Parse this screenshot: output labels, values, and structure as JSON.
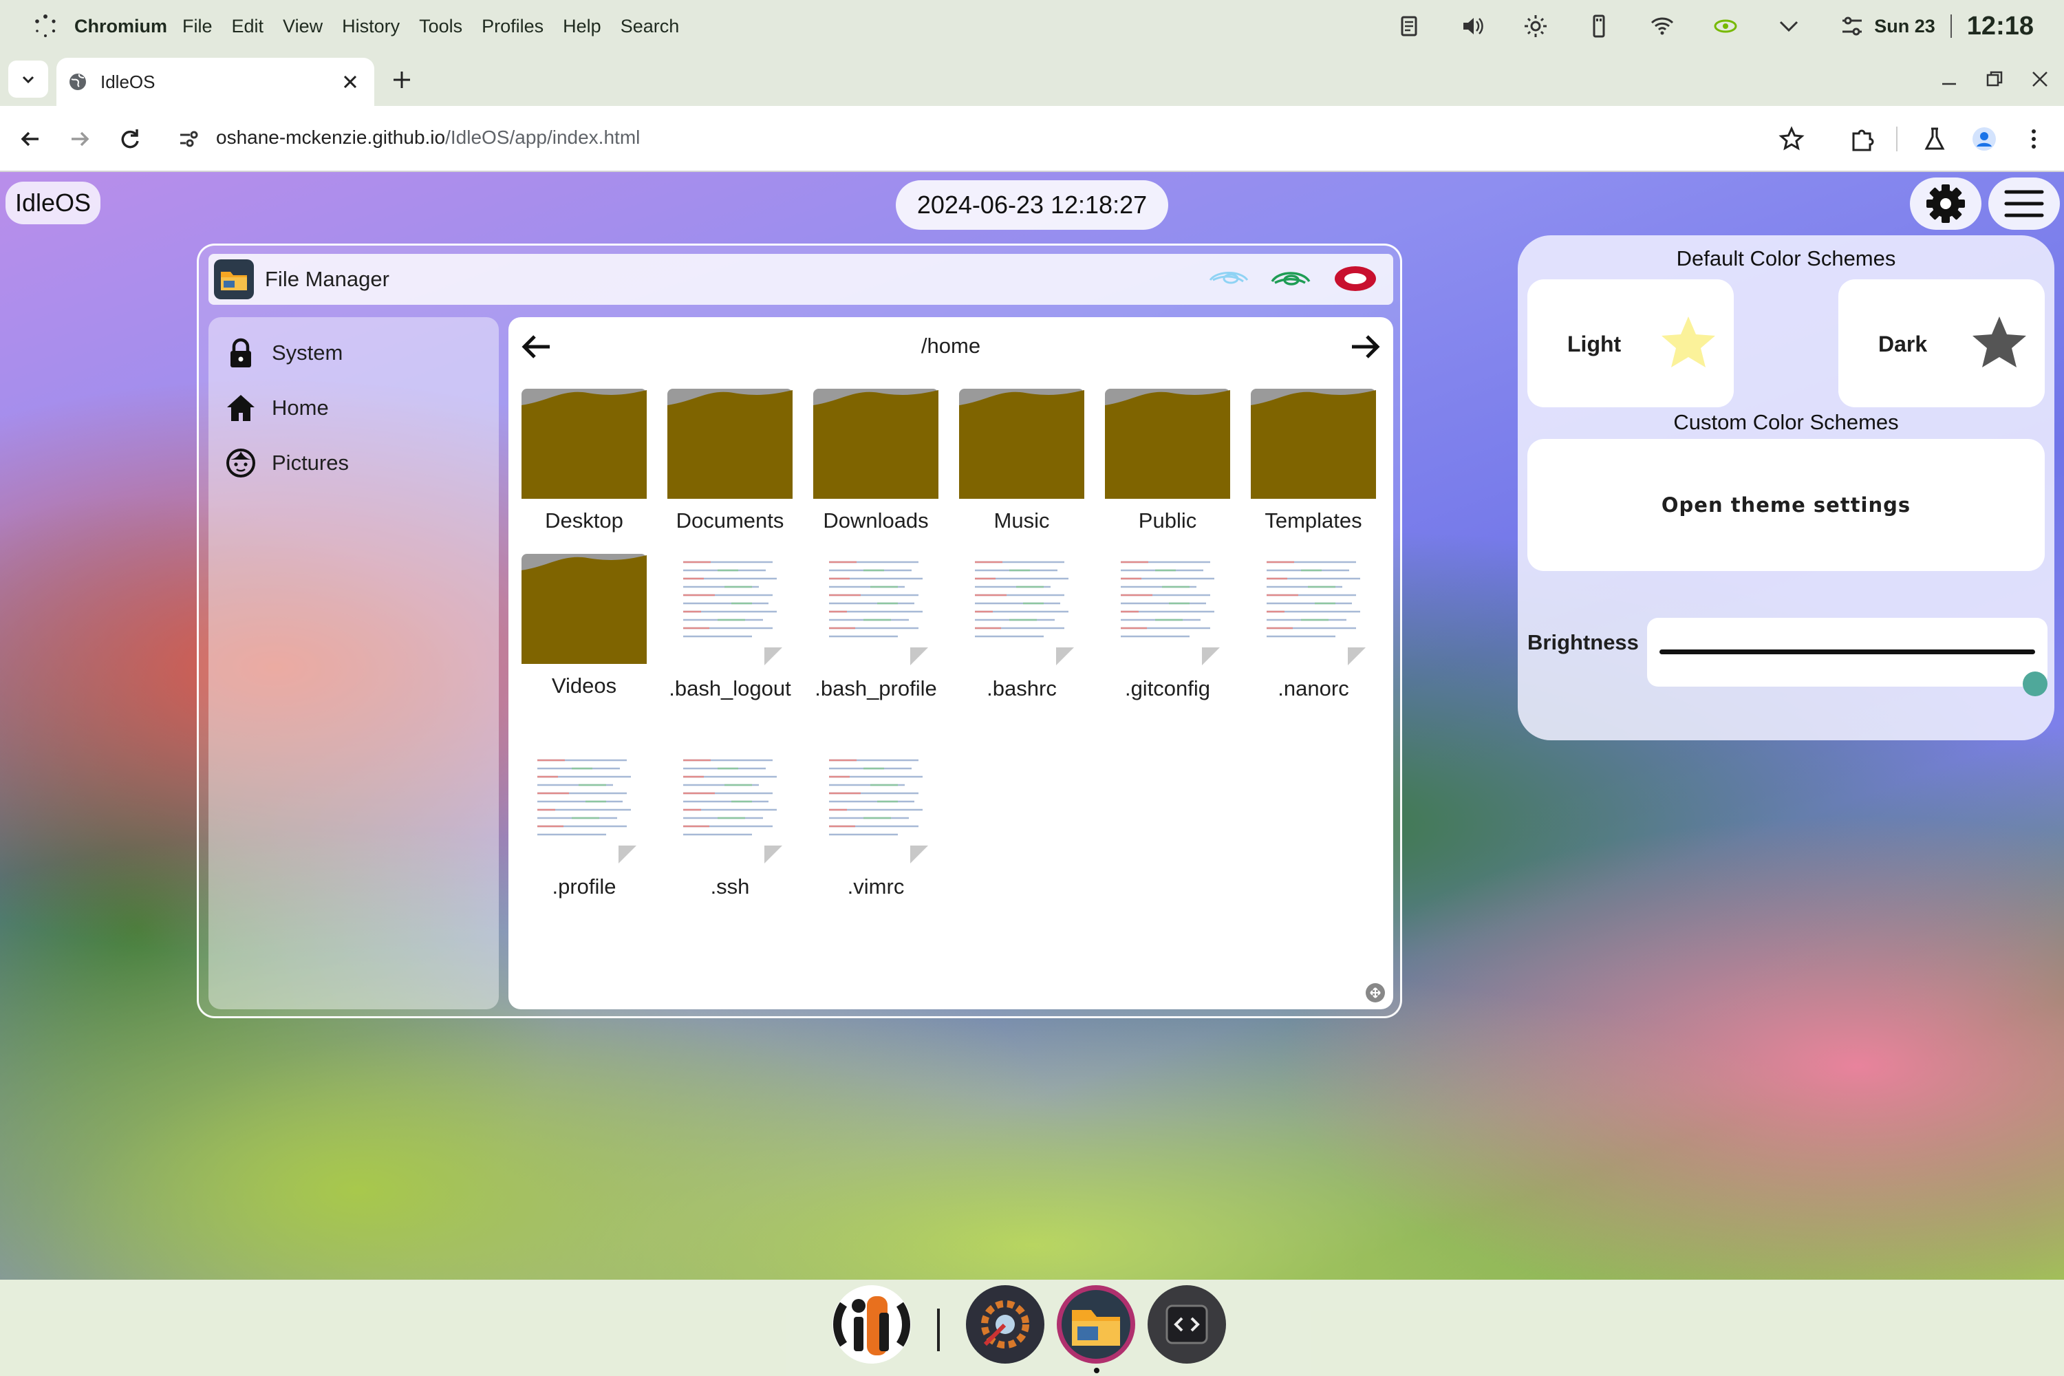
{
  "system_bar": {
    "app_name": "Chromium",
    "menu": [
      "File",
      "Edit",
      "View",
      "History",
      "Tools",
      "Profiles",
      "Help",
      "Search"
    ],
    "date": "Sun 23",
    "time": "12:18"
  },
  "browser": {
    "tab_title": "IdleOS",
    "url_host": "oshane-mckenzie.github.io",
    "url_path": "/IdleOS/app/index.html"
  },
  "desktop": {
    "brand": "IdleOS",
    "clock": "2024-06-23 12:18:27"
  },
  "file_manager": {
    "title": "File Manager",
    "sidebar": [
      {
        "label": "System",
        "icon": "lock-icon"
      },
      {
        "label": "Home",
        "icon": "home-icon"
      },
      {
        "label": "Pictures",
        "icon": "face-icon"
      }
    ],
    "path": "/home",
    "items": [
      {
        "label": "Desktop",
        "kind": "folder"
      },
      {
        "label": "Documents",
        "kind": "folder"
      },
      {
        "label": "Downloads",
        "kind": "folder"
      },
      {
        "label": "Music",
        "kind": "folder"
      },
      {
        "label": "Public",
        "kind": "folder"
      },
      {
        "label": "Templates",
        "kind": "folder"
      },
      {
        "label": "Videos",
        "kind": "folder"
      },
      {
        "label": ".bash_logout",
        "kind": "file"
      },
      {
        "label": ".bash_profile",
        "kind": "file"
      },
      {
        "label": ".bashrc",
        "kind": "file"
      },
      {
        "label": ".gitconfig",
        "kind": "file"
      },
      {
        "label": ".nanorc",
        "kind": "file"
      },
      {
        "label": ".profile",
        "kind": "file"
      },
      {
        "label": ".ssh",
        "kind": "file"
      },
      {
        "label": ".vimrc",
        "kind": "file"
      }
    ]
  },
  "theme_panel": {
    "default_heading": "Default Color Schemes",
    "light_label": "Light",
    "dark_label": "Dark",
    "custom_heading": "Custom Color Schemes",
    "open_settings_label": "Open theme settings",
    "brightness_label": "Brightness",
    "brightness_value": 1.0
  },
  "dock": {
    "apps": [
      "idleos-logo-icon",
      "settings-app-icon",
      "file-manager-app-icon",
      "code-editor-app-icon"
    ]
  },
  "colors": {
    "folder": "#7f6400",
    "brightness_thumb": "#4fa89a"
  }
}
